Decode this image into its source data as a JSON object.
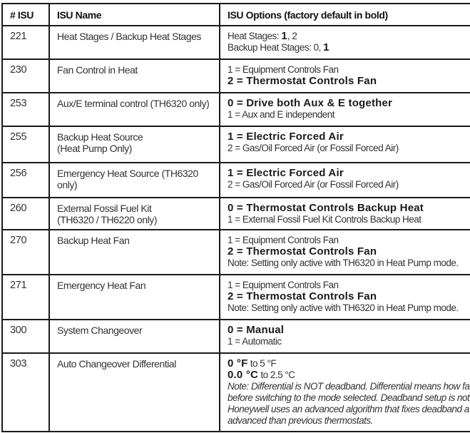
{
  "table": {
    "headers": [
      "# ISU",
      "ISU Name",
      "ISU Options (factory default in bold)"
    ],
    "rows": [
      {
        "isu": "221",
        "name": "Heat Stages / Backup Heat Stages",
        "options": [
          {
            "prefix": "Heat Stages: ",
            "bold": "1",
            "suffix": ", 2"
          },
          {
            "prefix": "Backup Heat Stages: 0, ",
            "bold": "1",
            "suffix": ""
          }
        ]
      },
      {
        "isu": "230",
        "name": "Fan Control in Heat",
        "options": [
          {
            "text": "1 = Equipment Controls Fan"
          },
          {
            "bold": "2 = Thermostat Controls Fan"
          }
        ]
      },
      {
        "isu": "253",
        "name": "Aux/E terminal control (TH6320 only)",
        "options": [
          {
            "bold": "0 = Drive both Aux & E together"
          },
          {
            "text": "1 = Aux and E independent"
          }
        ]
      },
      {
        "isu": "255",
        "name": "Backup Heat Source",
        "name_line2": "(Heat Pump Only)",
        "options": [
          {
            "bold": "1 = Electric Forced Air"
          },
          {
            "text": "2 = Gas/Oil Forced Air (or Fossil Forced Air)"
          }
        ]
      },
      {
        "isu": "256",
        "name": "Emergency Heat Source (TH6320 only)",
        "options": [
          {
            "bold": "1 = Electric Forced Air"
          },
          {
            "text": "2 = Gas/Oil Forced Air (or Fossil Forced Air)"
          }
        ]
      },
      {
        "isu": "260",
        "name": "External Fossil Fuel Kit",
        "name_line2": "(TH6320 / TH6220 only)",
        "options": [
          {
            "bold": "0 = Thermostat Controls Backup Heat"
          },
          {
            "text": "1 = External Fossil Fuel Kit Controls Backup Heat"
          }
        ]
      },
      {
        "isu": "270",
        "name": "Backup Heat Fan",
        "options": [
          {
            "text": "1 = Equipment Controls Fan"
          },
          {
            "bold": "2 = Thermostat Controls Fan"
          },
          {
            "text": "Note: Setting only active with TH6320 in Heat Pump mode."
          }
        ]
      },
      {
        "isu": "271",
        "name": "Emergency Heat Fan",
        "options": [
          {
            "text": "1 = Equipment Controls Fan"
          },
          {
            "bold": "2 = Thermostat Controls Fan"
          },
          {
            "text": "Note: Setting only active with TH6320 in Heat Pump mode."
          }
        ]
      },
      {
        "isu": "300",
        "name": "System Changeover",
        "options": [
          {
            "bold": "0 = Manual"
          },
          {
            "text": "1 = Automatic"
          }
        ]
      },
      {
        "isu": "303",
        "name": "Auto Changeover Differential",
        "options": [
          {
            "bold": "0 °F",
            "suffix": " to 5 °F"
          },
          {
            "bold": "0.0 °C",
            "suffix": " to 2.5 °C"
          },
          {
            "italic": "Note: Differential is NOT deadband. Differential means how fa"
          },
          {
            "italic": "before switching to the mode selected. Deadband setup is not"
          },
          {
            "italic": "Honeywell uses an advanced algorithm that fixes deadband a"
          },
          {
            "italic": "advanced than previous thermostats."
          }
        ]
      }
    ]
  }
}
